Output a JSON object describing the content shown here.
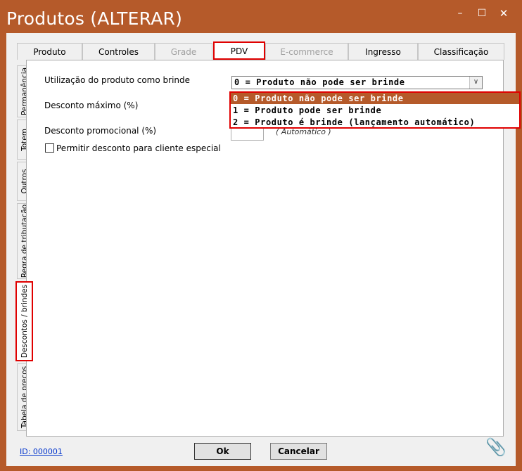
{
  "window": {
    "title": "Produtos (ALTERAR)",
    "controls": {
      "minimize": "–",
      "maximize": "☐",
      "close": "✕"
    }
  },
  "top_tabs": [
    {
      "label": "Produto",
      "state": "normal"
    },
    {
      "label": "Controles",
      "state": "normal"
    },
    {
      "label": "Grade",
      "state": "disabled"
    },
    {
      "label": "PDV",
      "state": "active"
    },
    {
      "label": "E-commerce",
      "state": "disabled"
    },
    {
      "label": "Ingresso",
      "state": "normal"
    },
    {
      "label": "Classificação",
      "state": "normal"
    }
  ],
  "side_tabs": [
    {
      "label": "Permanência"
    },
    {
      "label": "Totem"
    },
    {
      "label": "Outros"
    },
    {
      "label": "Regra de tributação"
    },
    {
      "label": "Descontos / brindes"
    },
    {
      "label": "Tabela de preços"
    }
  ],
  "form": {
    "brinde_label": "Utilização do produto como brinde",
    "brinde_value": "0 = Produto não pode ser brinde",
    "brinde_options": [
      "0 = Produto não pode ser brinde",
      "1 = Produto pode ser brinde",
      "2 = Produto é brinde (lançamento automático)"
    ],
    "desconto_maximo_label": "Desconto máximo (%)",
    "desconto_promocional_label": "Desconto promocional (%)",
    "automatico_label": "( Automático )",
    "cliente_especial_label": "Permitir desconto para cliente especial",
    "cliente_especial_checked": false
  },
  "footer": {
    "id_label": "ID: 000001",
    "ok_label": "Ok",
    "cancel_label": "Cancelar"
  },
  "colors": {
    "accent": "#b55a2a",
    "highlight": "#e00000"
  }
}
